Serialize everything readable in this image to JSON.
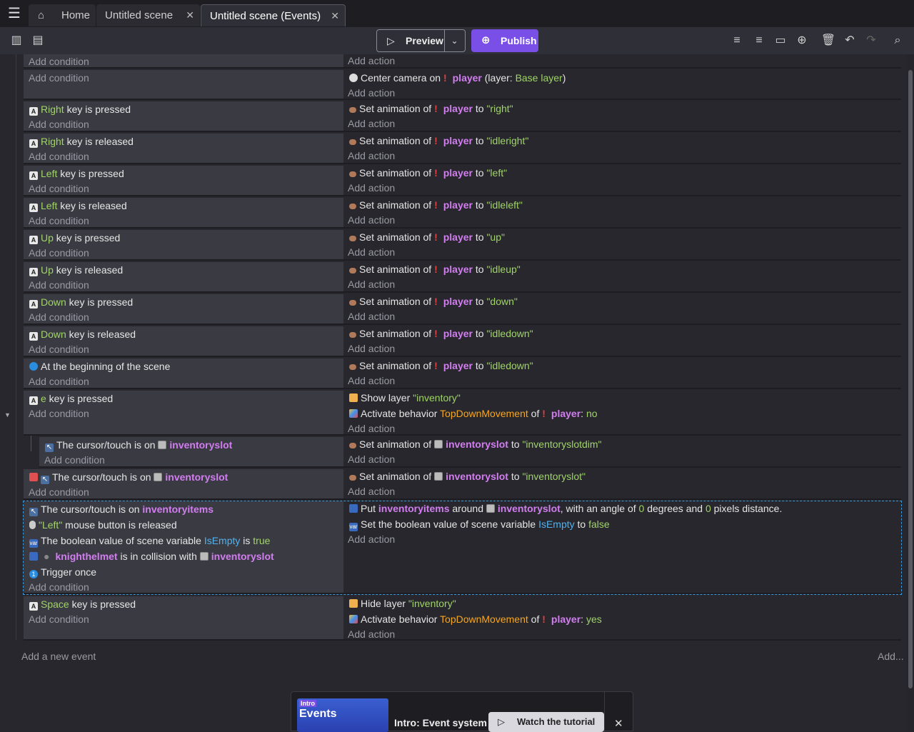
{
  "tabs": [
    {
      "label": "Home"
    },
    {
      "label": "Untitled scene"
    },
    {
      "label": "Untitled scene (Events)"
    }
  ],
  "toolbar": {
    "preview_label": "Preview",
    "publish_label": "Publish"
  },
  "common": {
    "add_condition": "Add condition",
    "add_action": "Add action"
  },
  "events": {
    "e0": {
      "a1": "Center camera on",
      "a1_obj": "player",
      "a1_mid": " (layer: ",
      "a1_layer": "Base layer",
      "a1_end": ")"
    },
    "e1": {
      "key": "Right",
      "tail": " key is pressed",
      "anim": "\"right\""
    },
    "e2": {
      "key": "Right",
      "tail": " key is released",
      "anim": "\"idleright\""
    },
    "e3": {
      "key": "Left",
      "tail": " key is pressed",
      "anim": "\"left\""
    },
    "e4": {
      "key": "Left",
      "tail": " key is released",
      "anim": "\"idleleft\""
    },
    "e5": {
      "key": "Up",
      "tail": " key is pressed",
      "anim": "\"up\""
    },
    "e6": {
      "key": "Up",
      "tail": " key is released",
      "anim": "\"idleup\""
    },
    "e7": {
      "key": "Down",
      "tail": " key is pressed",
      "anim": "\"down\""
    },
    "e8": {
      "key": "Down",
      "tail": " key is released",
      "anim": "\"idledown\""
    },
    "e9": {
      "cond": "At the beginning of the scene",
      "anim": "\"idledown\""
    },
    "e10": {
      "key": "e",
      "tail": " key is pressed",
      "a1": "Show layer ",
      "a1_val": "\"inventory\"",
      "a2": "Activate behavior ",
      "a2_beh": "TopDownMovement",
      "a2_of": " of ",
      "a2_obj": "player",
      "a2_colon": ": ",
      "a2_val": "no"
    },
    "e11": {
      "cond": "The cursor/touch is on ",
      "cond_obj": "inventoryslot",
      "a1": "Set animation of ",
      "a1_obj": "inventoryslot",
      "a1_to": " to ",
      "a1_val": "\"inventoryslotdim\""
    },
    "e12": {
      "cond": "The cursor/touch is on ",
      "cond_obj": "inventoryslot",
      "a1": "Set animation of ",
      "a1_obj": "inventoryslot",
      "a1_to": " to ",
      "a1_val": "\"inventoryslot\""
    },
    "e13": {
      "c1": "The cursor/touch is on ",
      "c1_obj": "inventoryitems",
      "c2_val": "\"Left\"",
      "c2": " mouse button is released",
      "c3": "The boolean value of scene variable ",
      "c3_var": "IsEmpty",
      "c3_is": " is ",
      "c3_val": "true",
      "c4_obj": "knighthelmet",
      "c4": " is in collision with ",
      "c4_obj2": "inventoryslot",
      "c5": "Trigger once",
      "a1": "Put ",
      "a1_obj": "inventoryitems",
      "a1_around": " around ",
      "a1_obj2": "inventoryslot",
      "a1_angle": ", with an angle of ",
      "a1_v1": "0",
      "a1_deg": " degrees and ",
      "a1_v2": "0",
      "a1_px": " pixels distance.",
      "a2": "Set the boolean value of scene variable ",
      "a2_var": "IsEmpty",
      "a2_to": " to ",
      "a2_val": "false"
    },
    "e14": {
      "key": "Space",
      "tail": " key is pressed",
      "a1": "Hide layer ",
      "a1_val": "\"inventory\"",
      "a2": "Activate behavior ",
      "a2_beh": "TopDownMovement",
      "a2_of": " of ",
      "a2_obj": "player",
      "a2_colon": ": ",
      "a2_val": "yes"
    }
  },
  "anim": {
    "prefix": "Set animation of ",
    "obj": "player",
    "to": " to "
  },
  "add_new_event": "Add a new event",
  "add_more": "Add...",
  "tutorial": {
    "badge": "Intro",
    "thumb_title": "Events",
    "title": "Intro: Event system",
    "button": "Watch the tutorial"
  },
  "colors": {
    "accent": "#7a4fe8",
    "object": "#d27df0",
    "value": "#a0d468",
    "behavior": "#f5a623",
    "variable": "#4fb3f0"
  }
}
